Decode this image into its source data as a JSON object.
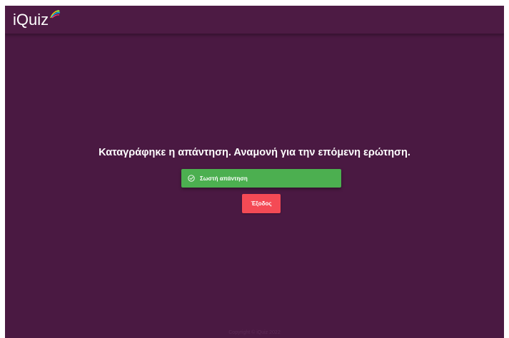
{
  "header": {
    "logo_text": "iQuiz",
    "logo_icon": "colorful-feather-icon"
  },
  "main": {
    "message": "Καταγράφηκε η απάντηση. Αναμονή για την επόμενη ερώτηση.",
    "result": {
      "label": "Σωστή απάντηση",
      "icon": "check-circle-icon",
      "color": "#4caf50"
    },
    "exit_label": "Έξοδος",
    "exit_color": "#f44a55"
  },
  "footer": {
    "copyright": "Copyright © iQuiz 2022"
  },
  "colors": {
    "background": "#4a1942",
    "topbar": "#4d1b44"
  }
}
